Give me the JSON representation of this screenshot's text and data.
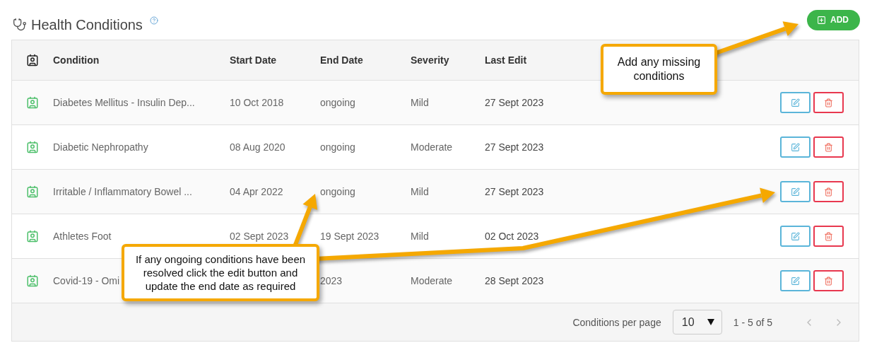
{
  "header": {
    "title": "Health Conditions",
    "add_button": "ADD"
  },
  "table": {
    "columns": [
      "Condition",
      "Start Date",
      "End Date",
      "Severity",
      "Last Edit"
    ],
    "rows": [
      {
        "condition": "Diabetes Mellitus - Insulin Dep...",
        "start_date": "10 Oct 2018",
        "end_date": "ongoing",
        "severity": "Mild",
        "last_edit": "27 Sept 2023"
      },
      {
        "condition": "Diabetic Nephropathy",
        "start_date": "08 Aug 2020",
        "end_date": "ongoing",
        "severity": "Moderate",
        "last_edit": "27 Sept 2023"
      },
      {
        "condition": "Irritable / Inflammatory Bowel ...",
        "start_date": "04 Apr 2022",
        "end_date": "ongoing",
        "severity": "Mild",
        "last_edit": "27 Sept 2023"
      },
      {
        "condition": "Athletes Foot",
        "start_date": "02 Sept 2023",
        "end_date": "19 Sept 2023",
        "severity": "Mild",
        "last_edit": "02 Oct 2023"
      },
      {
        "condition": "Covid-19 - Omi",
        "end_date": "2023",
        "severity": "Moderate",
        "last_edit": "28 Sept 2023"
      }
    ]
  },
  "pagination": {
    "label": "Conditions per page",
    "per_page": "10",
    "range": "1 - 5 of 5",
    "prev": {
      "disabled": true
    },
    "next": {
      "disabled": true
    }
  },
  "callouts": [
    {
      "text": "Add any missing conditions"
    },
    {
      "text": "If any ongoing conditions have been resolved click the edit button and update the end date as required"
    }
  ]
}
